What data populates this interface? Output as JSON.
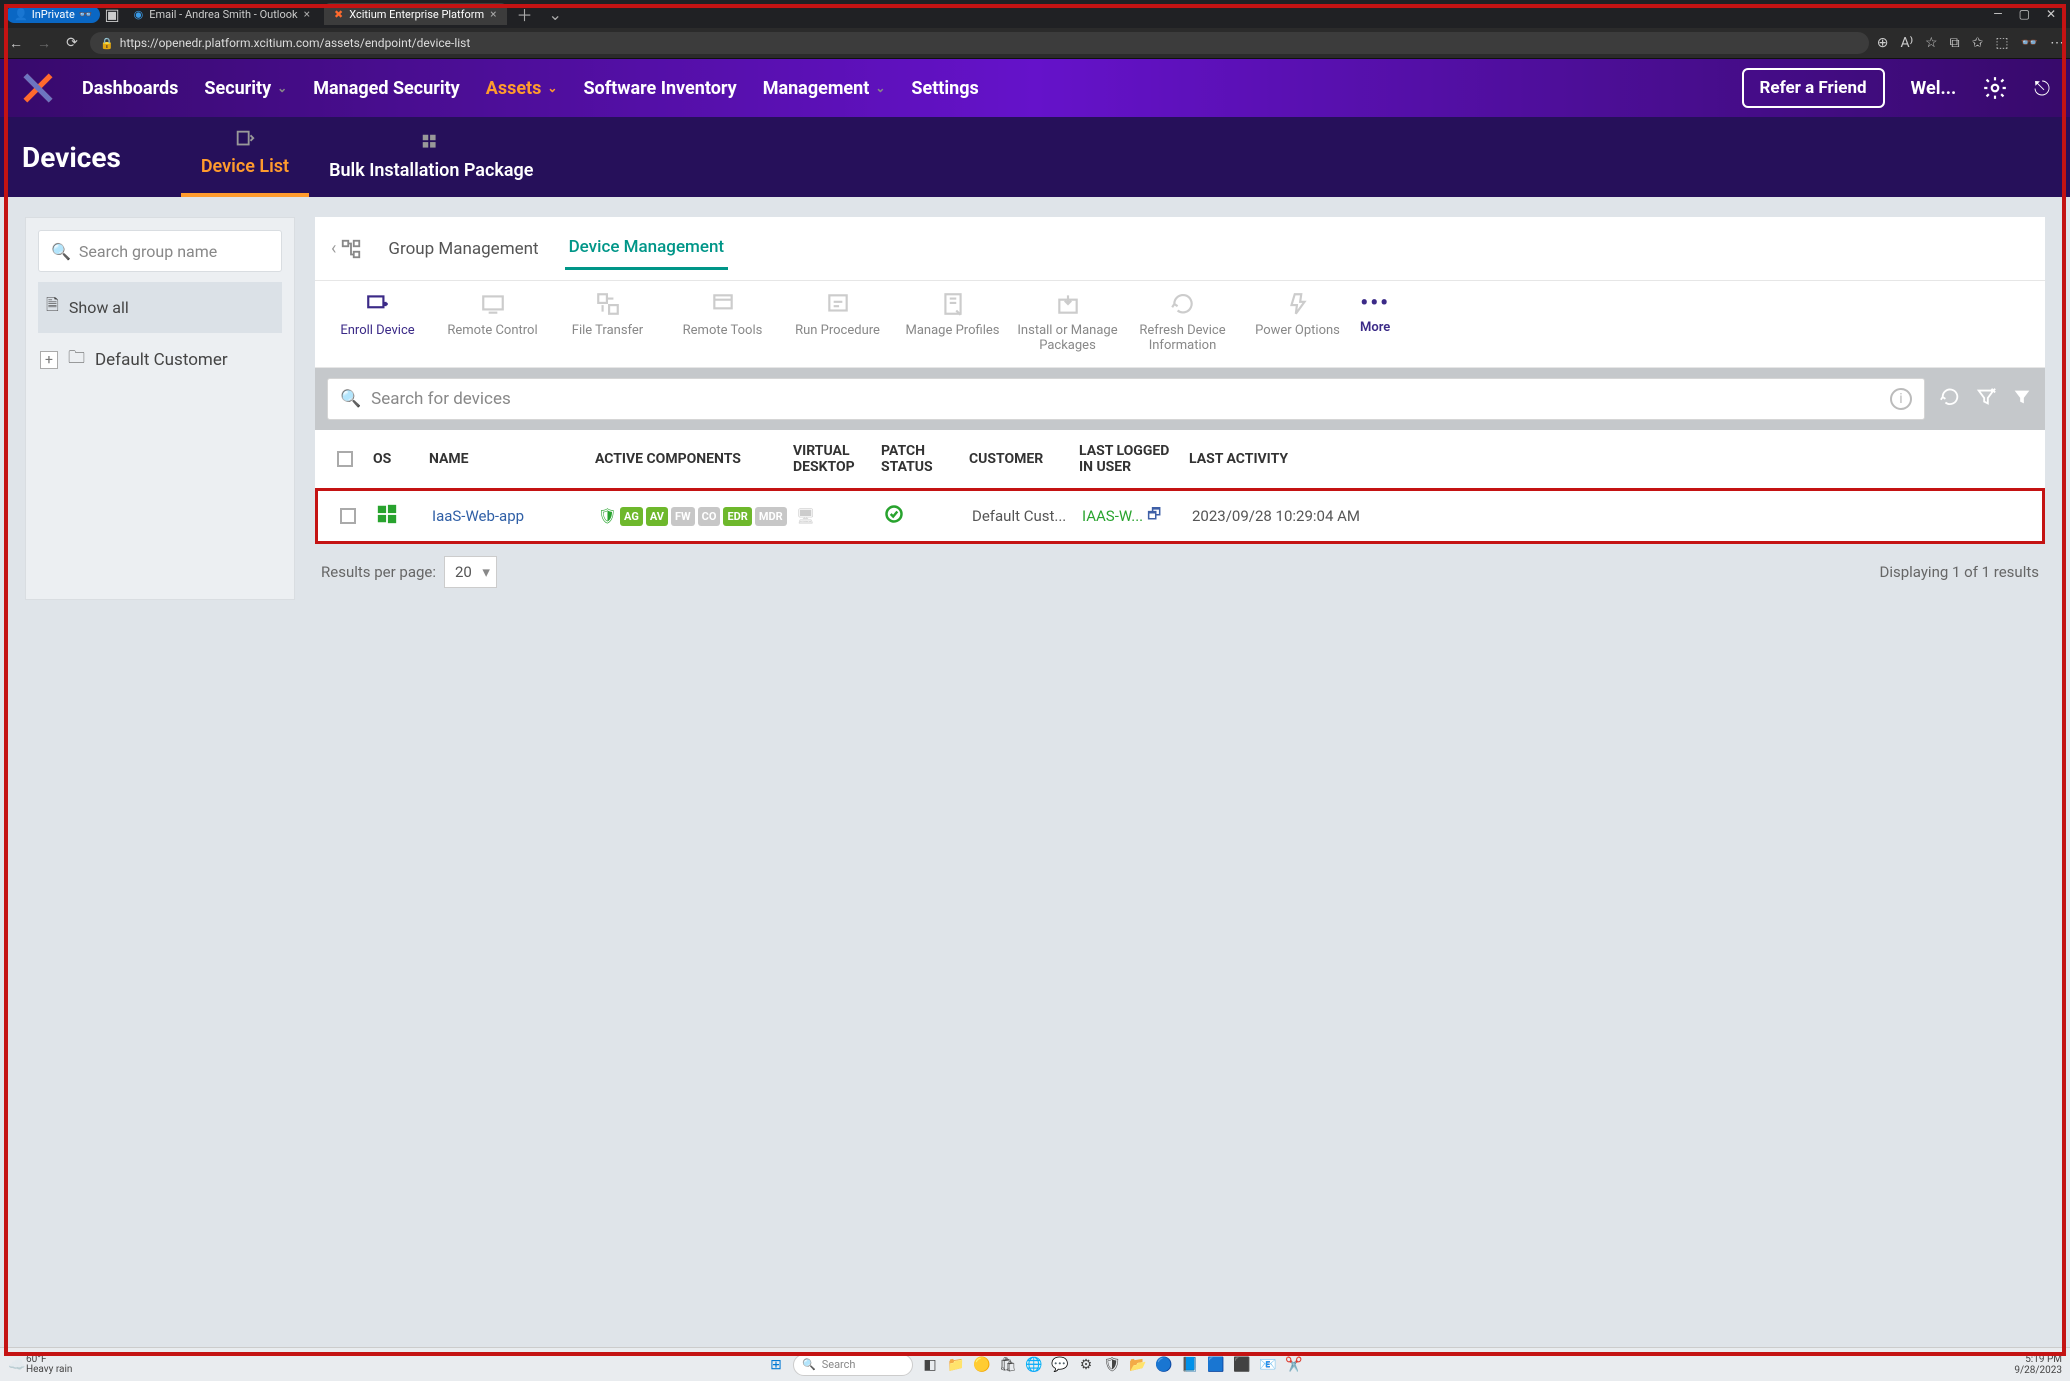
{
  "browser": {
    "inprivate": "InPrivate",
    "tabs": [
      {
        "title": "Email - Andrea Smith - Outlook"
      },
      {
        "title": "Xcitium Enterprise Platform"
      }
    ],
    "url": "https://openedr.platform.xcitium.com/assets/endpoint/device-list"
  },
  "topnav": {
    "items": [
      "Dashboards",
      "Security",
      "Managed Security",
      "Assets",
      "Software Inventory",
      "Management",
      "Settings"
    ],
    "active": "Assets",
    "refer": "Refer a Friend",
    "welcome": "Wel..."
  },
  "page": {
    "title": "Devices"
  },
  "subtabs": {
    "items": [
      "Device List",
      "Bulk Installation Package"
    ],
    "active": "Device List"
  },
  "left": {
    "search_placeholder": "Search group name",
    "show_all": "Show all",
    "root": "Default Customer"
  },
  "mgmt_tabs": {
    "items": [
      "Group Management",
      "Device Management"
    ],
    "active": "Device Management"
  },
  "toolbar": {
    "items": [
      "Enroll Device",
      "Remote Control",
      "File Transfer",
      "Remote Tools",
      "Run Procedure",
      "Manage Profiles",
      "Install or Manage Packages",
      "Refresh Device Information",
      "Power Options"
    ],
    "more": "More"
  },
  "device_search": {
    "placeholder": "Search for devices"
  },
  "columns": [
    "OS",
    "NAME",
    "ACTIVE COMPONENTS",
    "VIRTUAL DESKTOP",
    "PATCH STATUS",
    "CUSTOMER",
    "LAST LOGGED IN USER",
    "LAST ACTIVITY"
  ],
  "row": {
    "name": "IaaS-Web-app",
    "badges": [
      "AG",
      "AV",
      "FW",
      "CO",
      "EDR",
      "MDR"
    ],
    "badge_state": [
      "green",
      "green",
      "gray",
      "gray",
      "green",
      "gray"
    ],
    "customer": "Default Cust...",
    "user": "IAAS-W...",
    "activity": "2023/09/28 10:29:04 AM"
  },
  "pager": {
    "label": "Results per page:",
    "value": "20",
    "display": "Displaying 1 of 1 results"
  },
  "taskbar": {
    "temp": "60°F",
    "cond": "Heavy rain",
    "search": "Search",
    "time": "5:19 PM",
    "date": "9/28/2023"
  }
}
